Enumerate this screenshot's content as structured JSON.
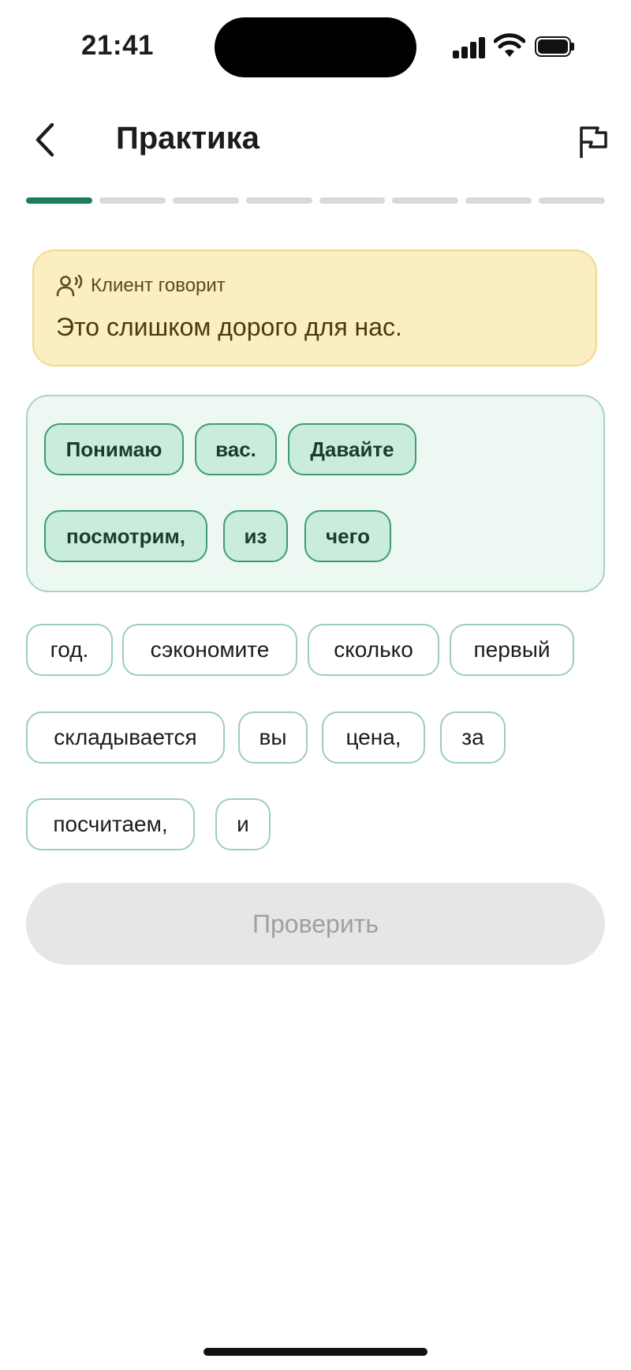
{
  "status_bar": {
    "time": "21:41"
  },
  "header": {
    "title": "Практика"
  },
  "progress": {
    "total_steps": 8,
    "completed_steps": 1
  },
  "client_card": {
    "label": "Клиент говорит",
    "text": "Это слишком дорого для нас.",
    "accent_color": "#faeec2"
  },
  "answer": {
    "selected_words": [
      "Понимаю",
      "вас.",
      "Давайте",
      "посмотрим,",
      "из",
      "чего"
    ]
  },
  "word_bank": {
    "words": [
      "год.",
      "сэкономите",
      "сколько",
      "первый",
      "складывается",
      "вы",
      "цена,",
      "за",
      "посчитаем,",
      "и"
    ]
  },
  "actions": {
    "check_label": "Проверить"
  },
  "colors": {
    "primary": "#1e7e5a",
    "chip_selected": "#c9ecdc",
    "disabled": "#e6e6e6"
  }
}
